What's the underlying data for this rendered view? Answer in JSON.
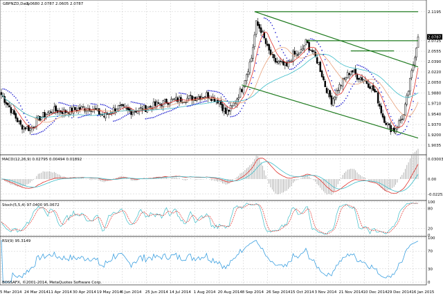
{
  "header": {
    "symbol": "GBPNZD,Daily",
    "ohlc": "2.0680 2.0787 2.0605 2.0787"
  },
  "footer": {
    "copyright": "BOSSAFX, ©2001-2014, MetaQuotes Software Corp."
  },
  "colors": {
    "bull_body": "#ffffff",
    "bear_body": "#000000",
    "ma_fast": "#e0302a",
    "ma_mid": "#e8a07a",
    "ma_slow": "#3cbcc8",
    "psar": "#1a1ad0",
    "channel": "#1e7a1e",
    "macd_line": "#e0302a",
    "macd_signal": "#3cbcc8",
    "stoch_main": "#3cbcc8",
    "stoch_signal": "#e0302a",
    "rsi": "#3ca0e0"
  },
  "chart_data": [
    {
      "type": "candlestick",
      "pane": "price",
      "title": "GBPNZD,Daily",
      "ylim": [
        1.89,
        2.135
      ],
      "y_tick_labels": [
        "2.1195",
        "2.0787",
        "2.0725",
        "2.0555",
        "2.0390",
        "2.0220",
        "2.0050",
        "1.9880",
        "1.9710",
        "1.9540",
        "1.9370",
        "1.9200",
        "1.9035"
      ],
      "y_ticks": [
        2.1195,
        2.0725,
        2.0555,
        2.039,
        2.022,
        2.005,
        1.988,
        1.971,
        1.954,
        1.937,
        1.92,
        1.9035
      ],
      "last_price": 2.0787,
      "x_tick_labels": [
        "5 Mar 2014",
        "24 Mar 2014",
        "11 Apr 2014",
        "30 Apr 2014",
        "19 May 2014",
        "6 Jun 2014",
        "25 Jun 2014",
        "14 Jul 2014",
        "1 Aug 2014",
        "20 Aug 2014",
        "8 Sep 2014",
        "26 Sep 2014",
        "15 Oct 2014",
        "3 Nov 2014",
        "21 Nov 2014",
        "10 Dec 2014",
        "29 Dec 2014",
        "16 Jan 2015"
      ],
      "close_anchors": [
        [
          0,
          1.985
        ],
        [
          5,
          1.965
        ],
        [
          12,
          1.935
        ],
        [
          18,
          1.93
        ],
        [
          24,
          1.948
        ],
        [
          32,
          1.96
        ],
        [
          40,
          1.958
        ],
        [
          48,
          1.962
        ],
        [
          56,
          1.964
        ],
        [
          64,
          1.95
        ],
        [
          72,
          1.965
        ],
        [
          80,
          1.958
        ],
        [
          88,
          1.962
        ],
        [
          96,
          1.968
        ],
        [
          104,
          1.975
        ],
        [
          112,
          1.978
        ],
        [
          120,
          1.98
        ],
        [
          128,
          1.985
        ],
        [
          136,
          1.975
        ],
        [
          140,
          1.955
        ],
        [
          144,
          1.965
        ],
        [
          150,
          1.995
        ],
        [
          156,
          2.045
        ],
        [
          159,
          2.1
        ],
        [
          162,
          2.09
        ],
        [
          166,
          2.06
        ],
        [
          170,
          2.04
        ],
        [
          174,
          2.035
        ],
        [
          178,
          2.03
        ],
        [
          182,
          2.05
        ],
        [
          186,
          2.05
        ],
        [
          190,
          2.07
        ],
        [
          194,
          2.055
        ],
        [
          198,
          2.035
        ],
        [
          202,
          2.0
        ],
        [
          206,
          1.975
        ],
        [
          210,
          1.995
        ],
        [
          214,
          2.01
        ],
        [
          218,
          2.025
        ],
        [
          222,
          2.015
        ],
        [
          226,
          2.01
        ],
        [
          230,
          2.0
        ],
        [
          234,
          1.985
        ],
        [
          238,
          1.95
        ],
        [
          242,
          1.932
        ],
        [
          245,
          1.928
        ],
        [
          248,
          1.94
        ],
        [
          251,
          1.952
        ],
        [
          254,
          1.992
        ],
        [
          257,
          2.035
        ],
        [
          260,
          2.0787
        ]
      ],
      "series": [
        {
          "name": "MA fast",
          "period": 8,
          "color_key": "ma_fast"
        },
        {
          "name": "MA mid",
          "period": 21,
          "color_key": "ma_mid"
        },
        {
          "name": "MA slow",
          "period": 50,
          "color_key": "ma_slow"
        }
      ],
      "channel": {
        "upper": [
          [
            158,
            2.1195
          ],
          [
            260,
            2.1195
          ]
        ],
        "mid_h1": [
          [
            190,
            2.0725
          ],
          [
            260,
            2.0725
          ]
        ],
        "mid_h2": [
          [
            218,
            2.056
          ],
          [
            245,
            2.056
          ]
        ],
        "descending_top": [
          [
            158,
            2.1195
          ],
          [
            260,
            2.03
          ]
        ],
        "descending_bottom": [
          [
            150,
            2.001
          ],
          [
            260,
            1.915
          ]
        ]
      }
    },
    {
      "type": "line",
      "pane": "macd",
      "title": "MACD(12,26,9) 0.02795 0.00494 0.01892",
      "ylim": [
        -0.03,
        0.034
      ],
      "y_tick_labels": [
        "0.03003",
        "0.00",
        "-0.02252"
      ],
      "y_ticks": [
        0.03003,
        0.0,
        -0.02252
      ],
      "series": [
        {
          "name": "MACD",
          "values_ref": "computed_from_close",
          "color_key": "macd_line"
        },
        {
          "name": "Signal",
          "values_ref": "computed_from_close",
          "color_key": "macd_signal"
        }
      ]
    },
    {
      "type": "line",
      "pane": "stochastic",
      "title": "Stoch(5,5,4) 97.0400 95.0672",
      "ylim": [
        0,
        100
      ],
      "y_tick_labels": [
        "100",
        "80",
        "20",
        "0"
      ],
      "y_ticks": [
        100,
        80,
        20,
        0
      ],
      "series": [
        {
          "name": "%K",
          "color_key": "stoch_main"
        },
        {
          "name": "%D",
          "color_key": "stoch_signal"
        }
      ]
    },
    {
      "type": "line",
      "pane": "rsi",
      "title": "RSI(9) 95.3149",
      "ylim": [
        0,
        100
      ],
      "y_tick_labels": [
        "100",
        "70",
        "30",
        "0"
      ],
      "y_ticks": [
        100,
        70,
        30,
        0
      ],
      "series": [
        {
          "name": "RSI",
          "color_key": "rsi"
        }
      ]
    }
  ]
}
